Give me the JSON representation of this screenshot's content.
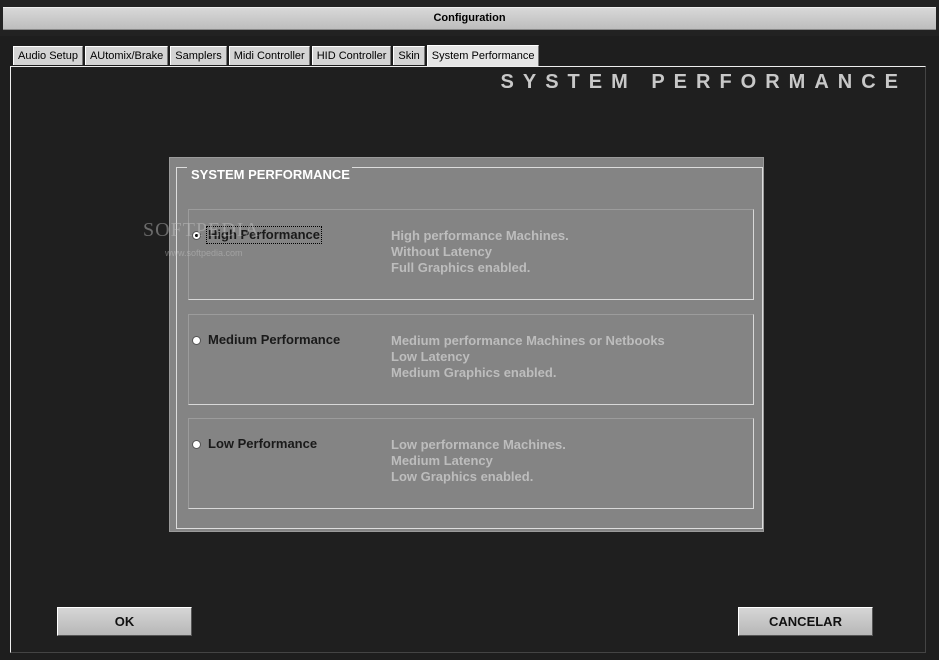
{
  "window": {
    "title": "Configuration"
  },
  "tabs": [
    {
      "label": "Audio Setup",
      "active": false
    },
    {
      "label": "AUtomix/Brake",
      "active": false
    },
    {
      "label": "Samplers",
      "active": false
    },
    {
      "label": "Midi Controller",
      "active": false
    },
    {
      "label": "HID Controller",
      "active": false
    },
    {
      "label": "Skin",
      "active": false
    },
    {
      "label": "System Performance",
      "active": true
    }
  ],
  "page": {
    "heading": "SYSTEM PERFORMANCE"
  },
  "group": {
    "legend": "SYSTEM PERFORMANCE",
    "options": [
      {
        "label": "High Performance",
        "selected": true,
        "description": [
          "High performance Machines.",
          "Without Latency",
          "Full Graphics enabled."
        ]
      },
      {
        "label": "Medium Performance",
        "selected": false,
        "description": [
          "Medium performance Machines or Netbooks",
          "Low Latency",
          "Medium Graphics enabled."
        ]
      },
      {
        "label": "Low Performance",
        "selected": false,
        "description": [
          "Low performance Machines.",
          "Medium Latency",
          "Low Graphics enabled."
        ]
      }
    ]
  },
  "watermark": {
    "text": "SOFTPEDIA",
    "sub": "www.softpedia.com"
  },
  "buttons": {
    "ok_label": "OK",
    "cancel_label": "CANCELAR"
  }
}
